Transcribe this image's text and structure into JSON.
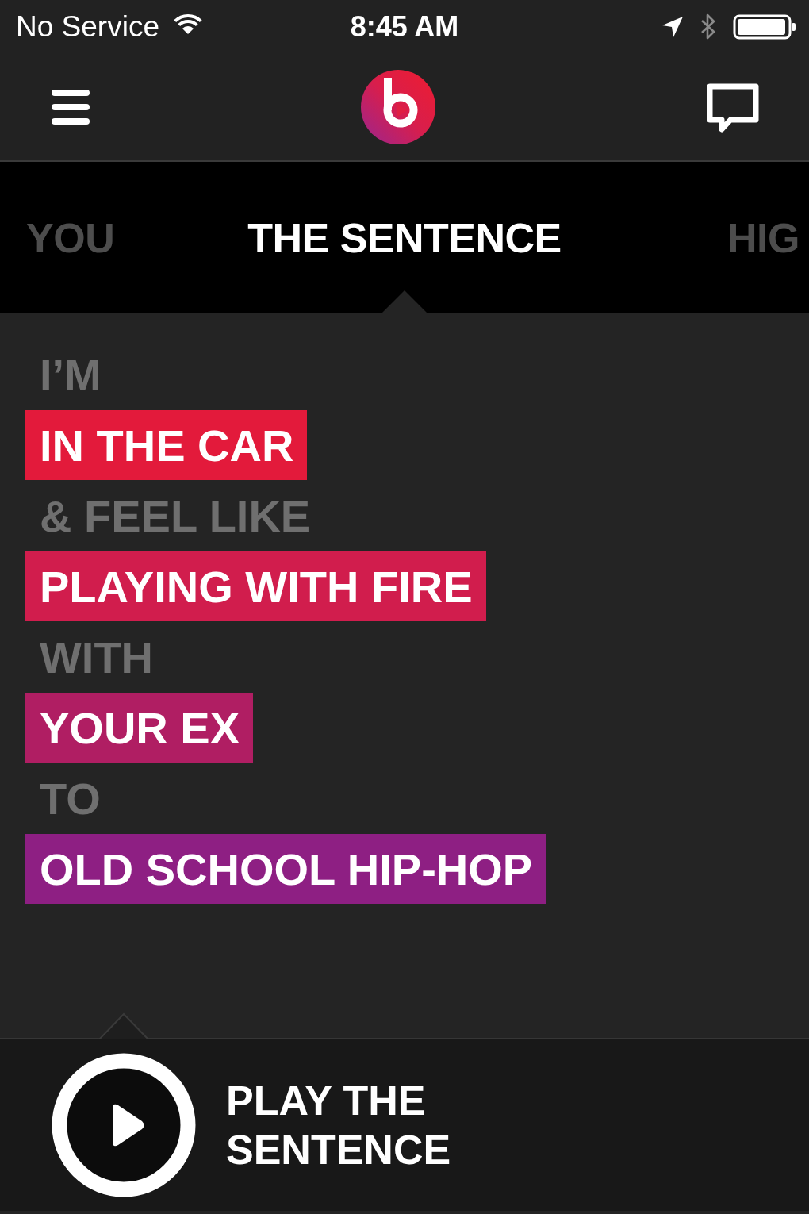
{
  "status_bar": {
    "carrier": "No Service",
    "time": "8:45 AM"
  },
  "tabs": [
    {
      "label": "YOU",
      "selected": false
    },
    {
      "label": "THE SENTENCE",
      "selected": true
    },
    {
      "label": "HIG",
      "selected": false
    }
  ],
  "sentence": [
    {
      "kind": "word",
      "text": "I’M"
    },
    {
      "kind": "choice",
      "text": "IN THE CAR",
      "color": "#e31a3b"
    },
    {
      "kind": "word",
      "text": "& FEEL LIKE"
    },
    {
      "kind": "choice",
      "text": "PLAYING WITH FIRE",
      "color": "#d11d4d"
    },
    {
      "kind": "word",
      "text": "WITH"
    },
    {
      "kind": "choice",
      "text": "YOUR EX",
      "color": "#b01e63"
    },
    {
      "kind": "word",
      "text": "TO"
    },
    {
      "kind": "choice",
      "text": "OLD SCHOOL HIP-HOP",
      "color": "#8e1f83"
    }
  ],
  "play_button": {
    "label": "PLAY THE SENTENCE"
  }
}
